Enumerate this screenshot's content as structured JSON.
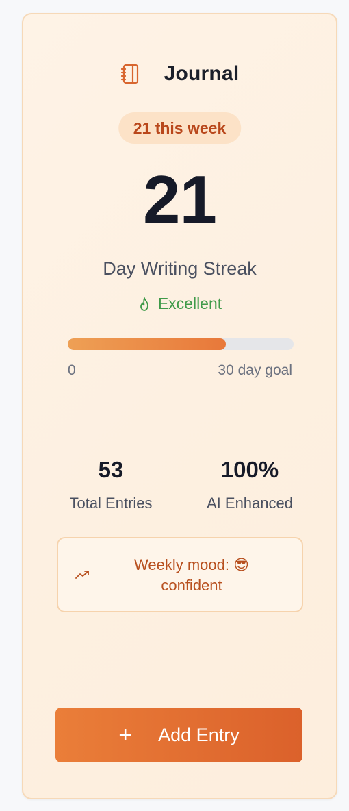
{
  "card": {
    "title": "Journal",
    "badge": "21 this week",
    "streak_value": "21",
    "streak_label": "Day Writing Streak",
    "status": "Excellent",
    "progress": {
      "fraction": 0.7,
      "min_label": "0",
      "max_label": "30 day goal"
    },
    "stats": [
      {
        "value": "53",
        "label": "Total Entries"
      },
      {
        "value": "100%",
        "label": "AI Enhanced"
      }
    ],
    "mood": {
      "line1": "Weekly mood: 😎",
      "line2": "confident"
    },
    "add_button": {
      "icon": "+",
      "label": "Add Entry"
    }
  },
  "icons": {
    "header": "notebook-icon",
    "status": "flame-icon",
    "mood": "trending-up-icon",
    "button": "plus-icon"
  },
  "colors": {
    "accent": "#e2692f",
    "badge_text": "#b9471b",
    "status_green": "#3f9a49"
  }
}
